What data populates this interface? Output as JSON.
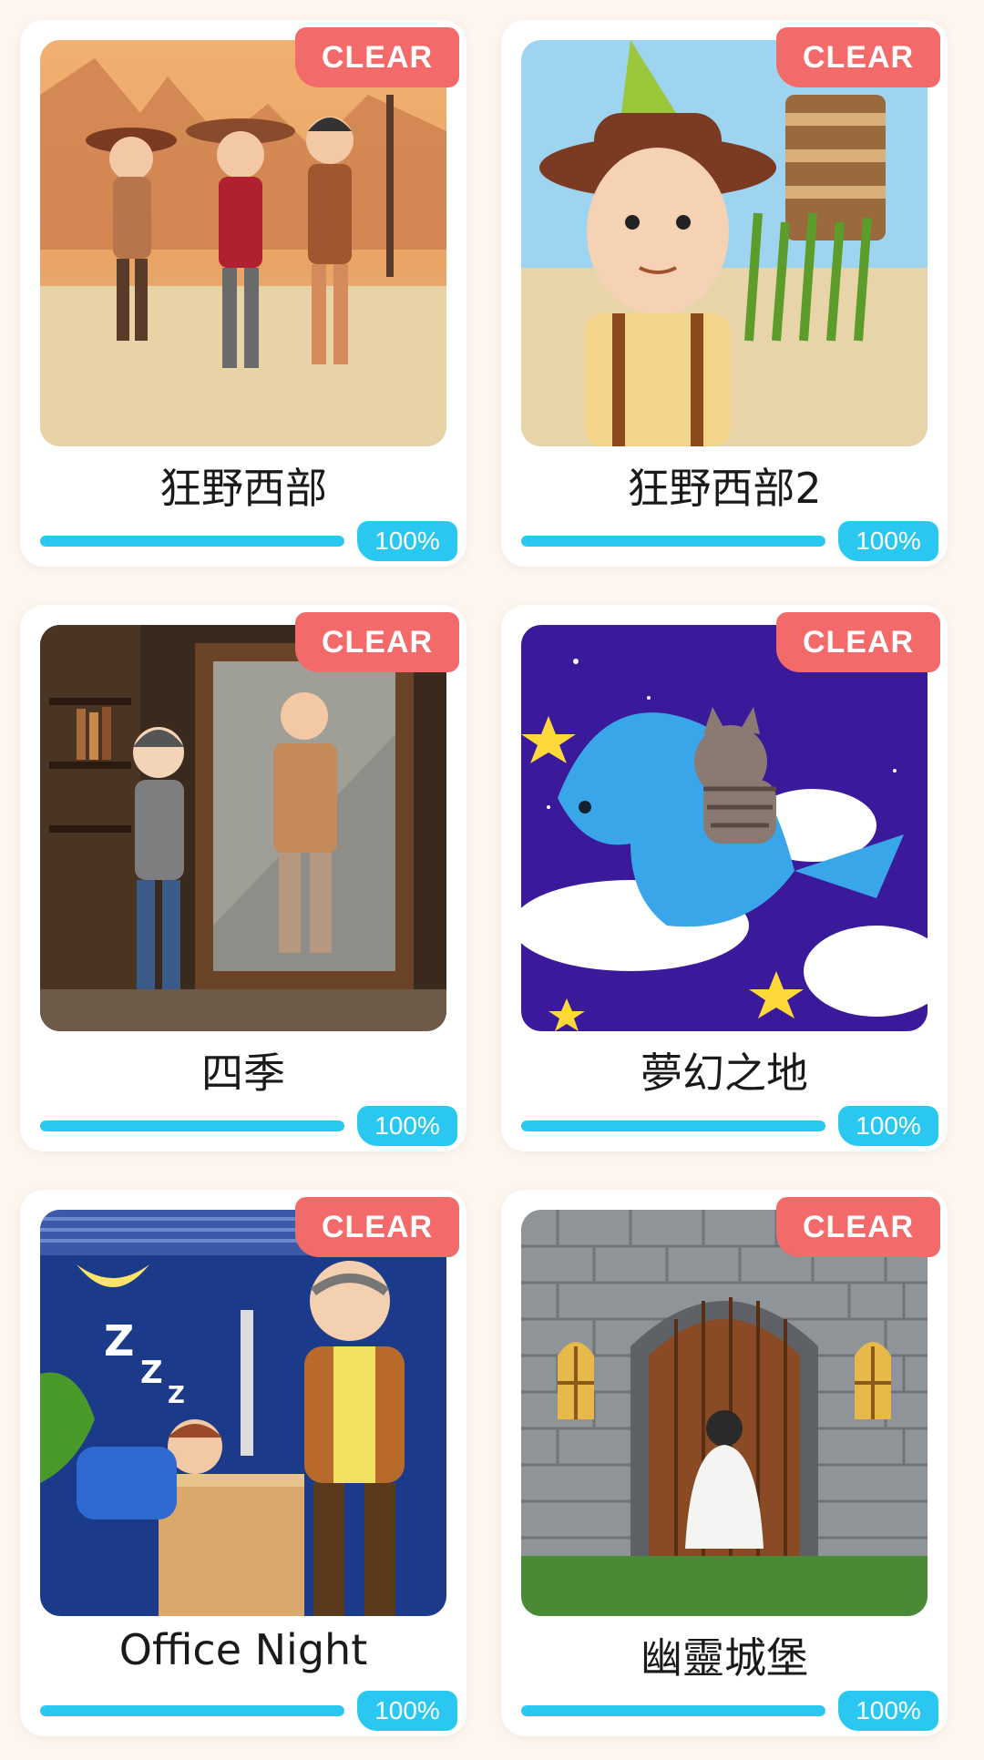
{
  "levels": [
    {
      "title": "狂野西部",
      "badge": "CLEAR",
      "progress_label": "100%",
      "progress": 1.0,
      "image": "wild-west-cowboys-illustration"
    },
    {
      "title": "狂野西部2",
      "badge": "CLEAR",
      "progress_label": "100%",
      "progress": 1.0,
      "image": "cowboy-farm-illustration"
    },
    {
      "title": "四季",
      "badge": "CLEAR",
      "progress_label": "100%",
      "progress": 1.0,
      "image": "mirror-old-man-illustration"
    },
    {
      "title": "夢幻之地",
      "badge": "CLEAR",
      "progress_label": "100%",
      "progress": 1.0,
      "image": "cat-riding-whale-illustration"
    },
    {
      "title": "Office Night",
      "badge": "CLEAR",
      "progress_label": "100%",
      "progress": 1.0,
      "image": "sleeping-office-worker-illustration"
    },
    {
      "title": "幽靈城堡",
      "badge": "CLEAR",
      "progress_label": "100%",
      "progress": 1.0,
      "image": "castle-door-ghost-illustration"
    }
  ],
  "colors": {
    "background": "#fdf6ef",
    "clear_badge": "#f26a6a",
    "progress": "#2ac8f0"
  }
}
